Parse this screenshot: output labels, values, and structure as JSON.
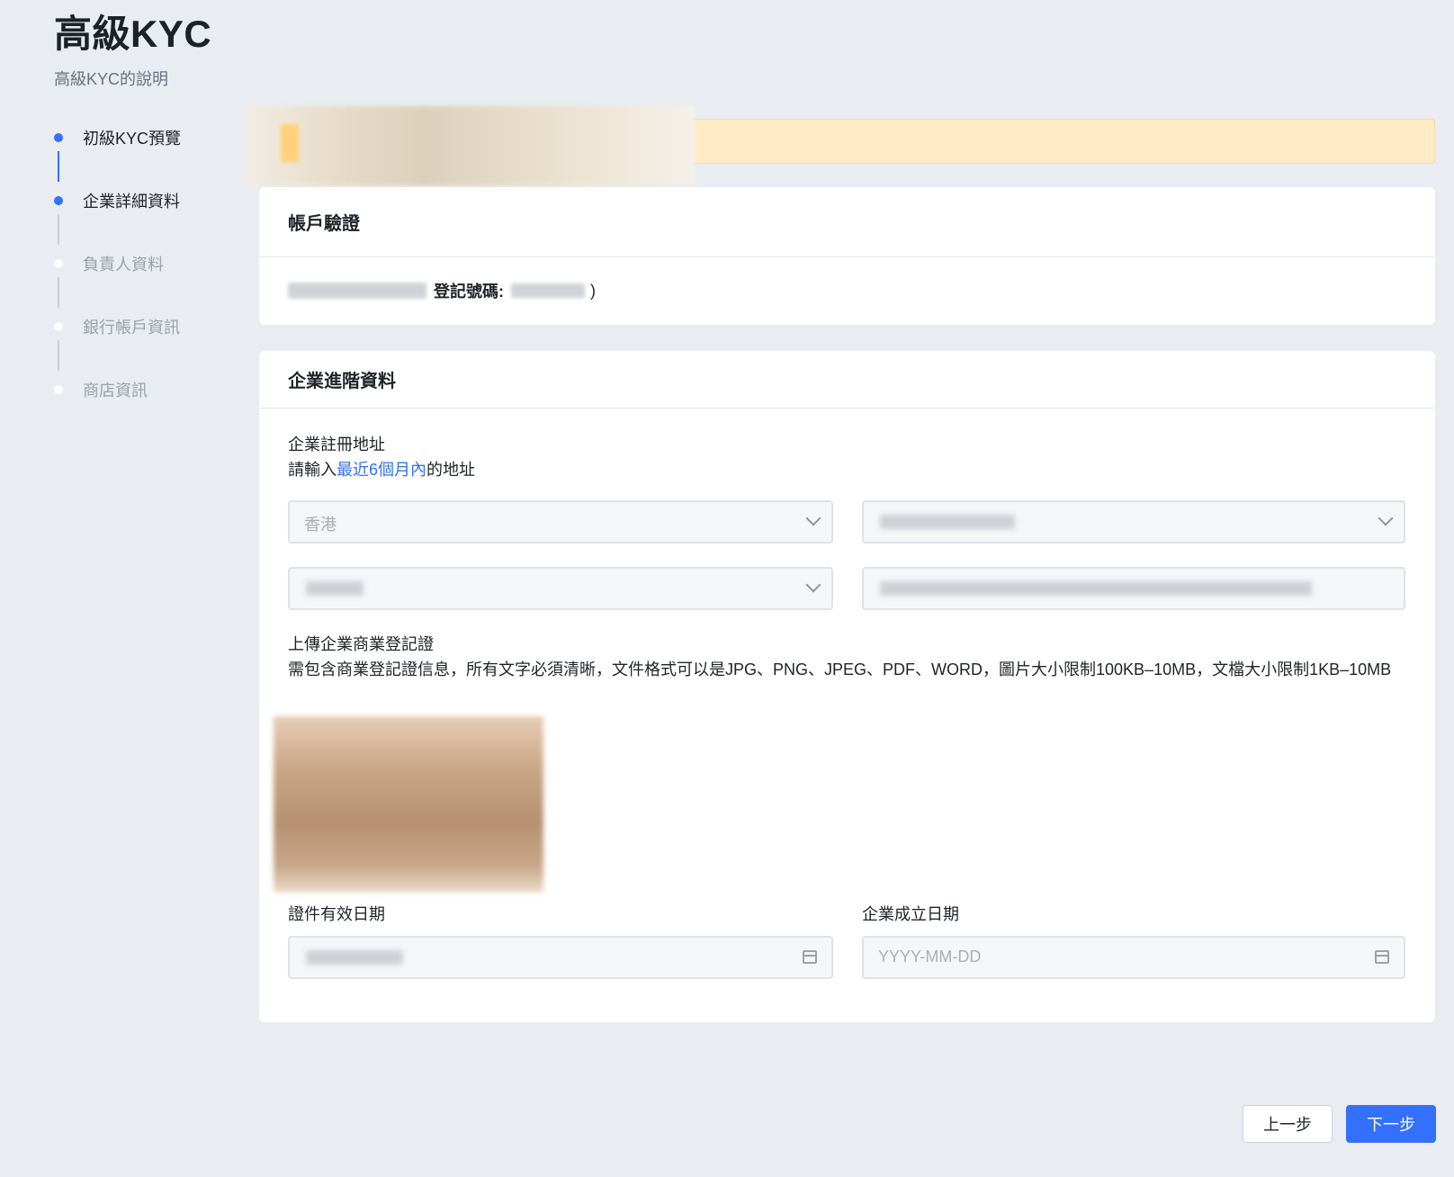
{
  "page": {
    "title": "高級KYC",
    "subtitle": "高級KYC的說明"
  },
  "steps": [
    {
      "label": "初級KYC預覽",
      "state": "done"
    },
    {
      "label": "企業詳細資料",
      "state": "current"
    },
    {
      "label": "負責人資料",
      "state": "pending"
    },
    {
      "label": "銀行帳戶資訊",
      "state": "pending"
    },
    {
      "label": "商店資訊",
      "state": "pending"
    }
  ],
  "account_card": {
    "title": "帳戶驗證",
    "reg_label": "登記號碼:",
    "close_paren": ")"
  },
  "business_card": {
    "title": "企業進階資料",
    "address_title": "企業註冊地址",
    "address_hint_prefix": "請輸入",
    "address_hint_link": "最近6個月內",
    "address_hint_suffix": "的地址",
    "country_value": "香港",
    "upload_title": "上傳企業商業登記證",
    "upload_hint": "需包含商業登記證信息，所有文字必須清晰，文件格式可以是JPG、PNG、JPEG、PDF、WORD，圖片大小限制100KB–10MB，文檔大小限制1KB–10MB",
    "cert_expiry_label": "證件有效日期",
    "founding_date_label": "企業成立日期",
    "founding_date_placeholder": "YYYY-MM-DD"
  },
  "buttons": {
    "prev": "上一步",
    "next": "下一步"
  },
  "colors": {
    "accent": "#3370ff",
    "background": "#e9ecf1",
    "notice": "#ffecc7"
  }
}
